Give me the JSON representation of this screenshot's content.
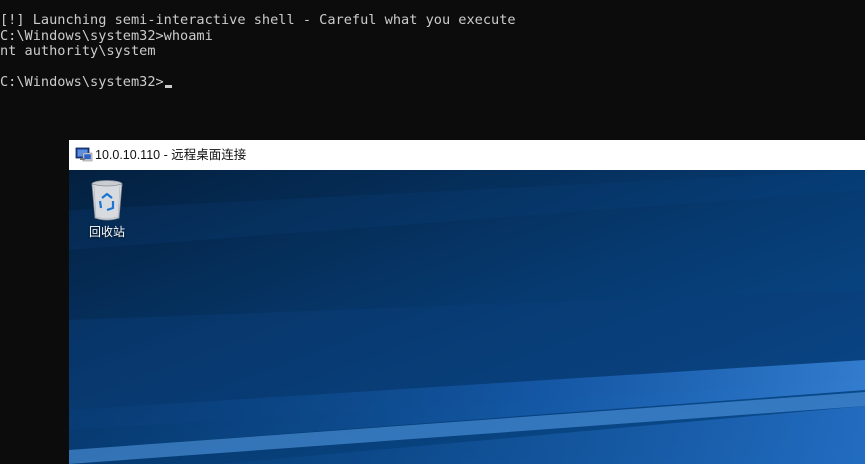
{
  "terminal": {
    "lines": [
      "[!] Launching semi-interactive shell - Careful what you execute",
      "C:\\Windows\\system32>whoami",
      "nt authority\\system",
      "",
      "C:\\Windows\\system32>"
    ],
    "text_color": "#cccccc",
    "background": "#0c0c0c"
  },
  "rdp_window": {
    "title": "10.0.10.110 - 远程桌面连接",
    "titlebar_color": "#ffffff",
    "desktop": {
      "icons": [
        {
          "label": "回收站",
          "icon": "recycle-bin-icon"
        }
      ],
      "wallpaper_colors": [
        "#062445",
        "#0a4a8c",
        "#1f6fcf"
      ]
    }
  }
}
